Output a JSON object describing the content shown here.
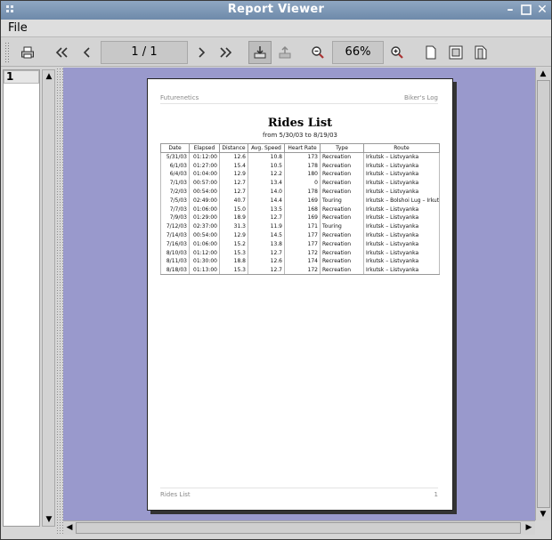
{
  "window": {
    "title": "Report Viewer"
  },
  "menu": {
    "file": "File"
  },
  "toolbar": {
    "page_indicator": "1 / 1",
    "zoom": "66%"
  },
  "page_list": {
    "items": [
      "1"
    ]
  },
  "report": {
    "header_left": "Futurenetics",
    "header_right": "Biker's Log",
    "title": "Rides List",
    "subtitle": "from 5/30/03 to 8/19/03",
    "columns": [
      "Date",
      "Elapsed",
      "Distance",
      "Avg. Speed",
      "Heart Rate",
      "Type",
      "Route"
    ],
    "rows": [
      [
        "5/31/03",
        "01:12:00",
        "12.6",
        "10.8",
        "173",
        "Recreation",
        "Irkutsk – Listvyanka"
      ],
      [
        "6/1/03",
        "01:27:00",
        "15.4",
        "10.5",
        "178",
        "Recreation",
        "Irkutsk – Listvyanka"
      ],
      [
        "6/4/03",
        "01:04:00",
        "12.9",
        "12.2",
        "180",
        "Recreation",
        "Irkutsk – Listvyanka"
      ],
      [
        "7/1/03",
        "00:57:00",
        "12.7",
        "13.4",
        "0",
        "Recreation",
        "Irkutsk – Listvyanka"
      ],
      [
        "7/2/03",
        "00:54:00",
        "12.7",
        "14.0",
        "178",
        "Recreation",
        "Irkutsk – Listvyanka"
      ],
      [
        "7/5/03",
        "02:49:00",
        "40.7",
        "14.4",
        "169",
        "Touring",
        "Irkutsk – Bolshoi Lug – Irkutsk"
      ],
      [
        "7/7/03",
        "01:06:00",
        "15.0",
        "13.5",
        "168",
        "Recreation",
        "Irkutsk – Listvyanka"
      ],
      [
        "7/9/03",
        "01:29:00",
        "18.9",
        "12.7",
        "169",
        "Recreation",
        "Irkutsk – Listvyanka"
      ],
      [
        "7/12/03",
        "02:37:00",
        "31.3",
        "11.9",
        "171",
        "Touring",
        "Irkutsk – Listvyanka"
      ],
      [
        "7/14/03",
        "00:54:00",
        "12.9",
        "14.5",
        "177",
        "Recreation",
        "Irkutsk – Listvyanka"
      ],
      [
        "7/16/03",
        "01:06:00",
        "15.2",
        "13.8",
        "177",
        "Recreation",
        "Irkutsk – Listvyanka"
      ],
      [
        "8/10/03",
        "01:12:00",
        "15.3",
        "12.7",
        "172",
        "Recreation",
        "Irkutsk – Listvyanka"
      ],
      [
        "8/11/03",
        "01:30:00",
        "18.8",
        "12.6",
        "174",
        "Recreation",
        "Irkutsk – Listvyanka"
      ],
      [
        "8/18/03",
        "01:13:00",
        "15.3",
        "12.7",
        "172",
        "Recreation",
        "Irkutsk – Listvyanka"
      ]
    ],
    "footer_left": "Rides List",
    "footer_right": "1"
  },
  "icons": [
    "print-icon",
    "first-page-icon",
    "previous-page-icon",
    "next-page-icon",
    "last-page-icon",
    "export-icon",
    "import-icon",
    "zoom-out-icon",
    "zoom-in-icon",
    "actual-size-icon",
    "fit-page-icon",
    "fit-width-icon"
  ],
  "colors": {
    "title_bar": "#7f99b8",
    "viewer_background": "#9999cc"
  }
}
